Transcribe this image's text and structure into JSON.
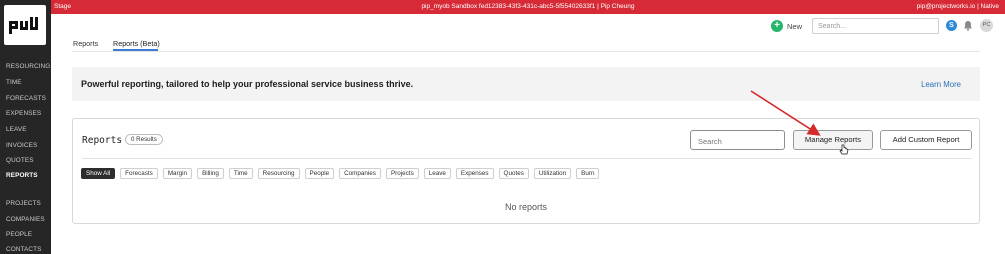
{
  "topbar": {
    "env": "Stage",
    "center": "pip_myob Sandbox fed12383-43f3-431c-abc5-5f55402633f1 | Pip Cheung",
    "user": "pip@projectworks.io | Native"
  },
  "sidebar": {
    "logo_icon": "projectworks-logo-icon",
    "items": [
      {
        "label": "RESOURCING"
      },
      {
        "label": "TIME"
      },
      {
        "label": "FORECASTS"
      },
      {
        "label": "EXPENSES"
      },
      {
        "label": "LEAVE"
      },
      {
        "label": "INVOICES"
      },
      {
        "label": "QUOTES"
      },
      {
        "label": "REPORTS"
      },
      {
        "label": "PROJECTS"
      },
      {
        "label": "COMPANIES"
      },
      {
        "label": "PEOPLE"
      },
      {
        "label": "CONTACTS"
      }
    ]
  },
  "header": {
    "new_label": "New",
    "search_placeholder": "Search...",
    "help_label": "S",
    "avatar_initials": "PC"
  },
  "tabs": [
    {
      "label": "Reports"
    },
    {
      "label": "Reports (Beta)"
    }
  ],
  "banner": {
    "text": "Powerful reporting, tailored to help your professional service business thrive.",
    "link": "Learn More"
  },
  "reports": {
    "title": "Reports",
    "count": "0 Results",
    "search_placeholder": "Search",
    "manage_label": "Manage Reports",
    "add_label": "Add Custom Report",
    "filters": [
      {
        "label": "Show All"
      },
      {
        "label": "Forecasts"
      },
      {
        "label": "Margin"
      },
      {
        "label": "Billing"
      },
      {
        "label": "Time"
      },
      {
        "label": "Resourcing"
      },
      {
        "label": "People"
      },
      {
        "label": "Companies"
      },
      {
        "label": "Projects"
      },
      {
        "label": "Leave"
      },
      {
        "label": "Expenses"
      },
      {
        "label": "Quotes"
      },
      {
        "label": "Utilization"
      },
      {
        "label": "Burn"
      }
    ],
    "empty_text": "No reports"
  },
  "colors": {
    "topbar": "#d62b37",
    "sidebar": "#262626",
    "accent": "#3a7bd5",
    "annotation_arrow": "#d42a2a"
  }
}
